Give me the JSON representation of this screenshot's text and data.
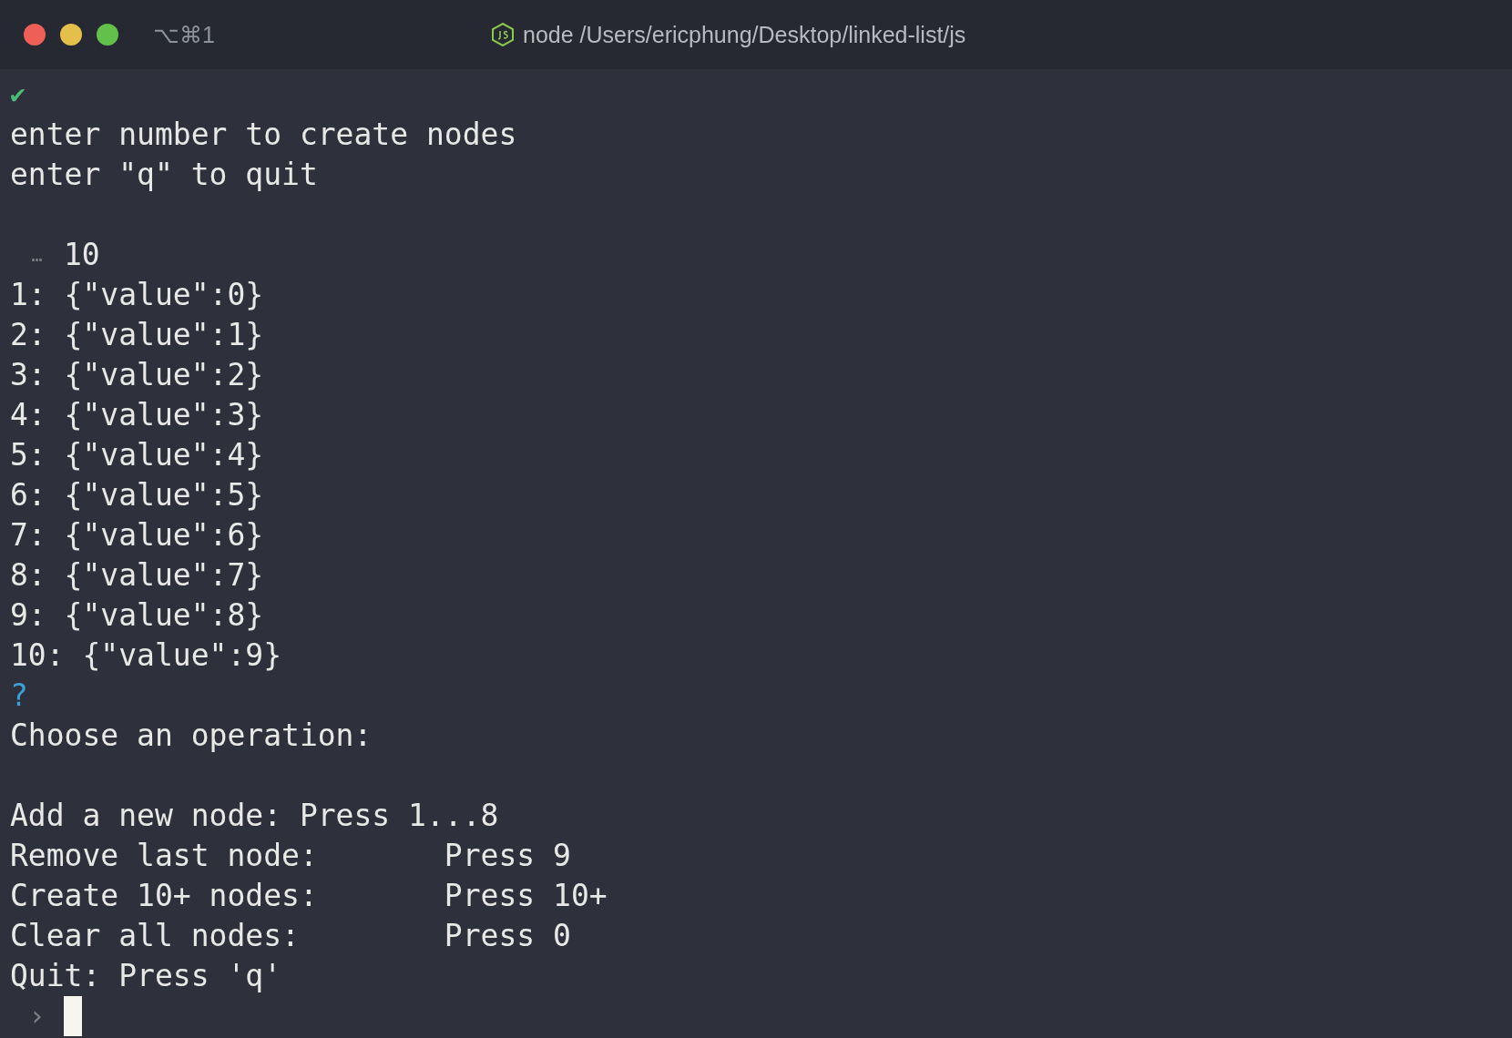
{
  "window": {
    "shortcut": "⌥⌘1",
    "title": "node /Users/ericphung/Desktop/linked-list/js"
  },
  "lines": [
    {
      "kind": "check",
      "text": "✔"
    },
    {
      "kind": "text",
      "text": "enter number to create nodes"
    },
    {
      "kind": "text",
      "text": "enter \"q\" to quit"
    },
    {
      "kind": "blank"
    },
    {
      "kind": "input",
      "prefix": "…",
      "text": "10"
    },
    {
      "kind": "text",
      "text": "1: {\"value\":0}"
    },
    {
      "kind": "text",
      "text": "2: {\"value\":1}"
    },
    {
      "kind": "text",
      "text": "3: {\"value\":2}"
    },
    {
      "kind": "text",
      "text": "4: {\"value\":3}"
    },
    {
      "kind": "text",
      "text": "5: {\"value\":4}"
    },
    {
      "kind": "text",
      "text": "6: {\"value\":5}"
    },
    {
      "kind": "text",
      "text": "7: {\"value\":6}"
    },
    {
      "kind": "text",
      "text": "8: {\"value\":7}"
    },
    {
      "kind": "text",
      "text": "9: {\"value\":8}"
    },
    {
      "kind": "text",
      "text": "10: {\"value\":9}"
    },
    {
      "kind": "question",
      "text": "?"
    },
    {
      "kind": "text",
      "text": "Choose an operation:"
    },
    {
      "kind": "blank"
    },
    {
      "kind": "text",
      "text": "Add a new node: Press 1...8"
    },
    {
      "kind": "text",
      "text": "Remove last node:       Press 9"
    },
    {
      "kind": "text",
      "text": "Create 10+ nodes:       Press 10+"
    },
    {
      "kind": "text",
      "text": "Clear all nodes:        Press 0"
    },
    {
      "kind": "text",
      "text": "Quit: Press 'q'"
    },
    {
      "kind": "prompt",
      "prefix": "›"
    }
  ]
}
